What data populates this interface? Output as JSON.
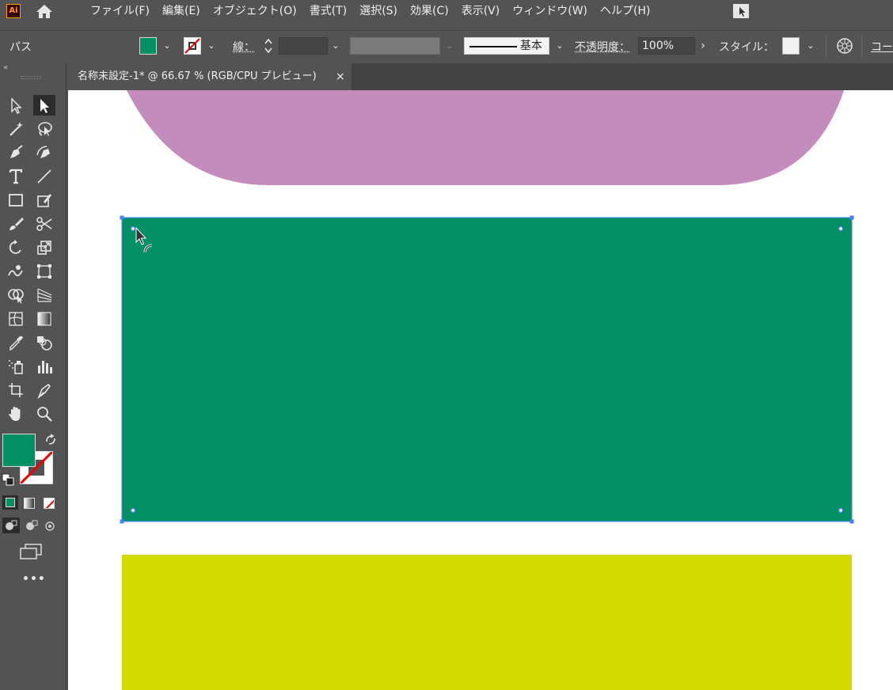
{
  "app": {
    "logo_text": "Ai"
  },
  "menu": [
    "ファイル(F)",
    "編集(E)",
    "オブジェクト(O)",
    "書式(T)",
    "選択(S)",
    "効果(C)",
    "表示(V)",
    "ウィンドウ(W)",
    "ヘルプ(H)"
  ],
  "control_bar": {
    "selection_type": "パス",
    "stroke_label": "線：",
    "stroke_profile": "基本",
    "opacity_label": "不透明度：",
    "opacity_value": "100%",
    "style_label": "スタイル：",
    "overflow_label": "コー"
  },
  "document_tab": {
    "title": "名称未設定-1* @ 66.67 % (RGB/CPU プレビュー)",
    "close": "×"
  },
  "colors": {
    "fill": "#009063",
    "stroke": "none",
    "shape_top": "#c48cbc",
    "shape_middle": "#009063",
    "shape_bottom": "#d2da00",
    "selection": "#4a7dff"
  },
  "toolbox": {
    "more_tools": "•••",
    "tools": [
      "selection-tool",
      "direct-selection-tool",
      "magic-wand-tool",
      "lasso-tool",
      "pen-tool",
      "curvature-tool",
      "type-tool",
      "line-segment-tool",
      "rectangle-tool",
      "shaper-tool",
      "paintbrush-tool",
      "scissors-tool",
      "rotate-tool",
      "scale-tool",
      "warp-tool",
      "free-transform-tool",
      "shape-builder-tool",
      "perspective-grid-tool",
      "mesh-tool",
      "gradient-tool",
      "eyedropper-tool",
      "blend-tool",
      "symbol-sprayer-tool",
      "column-graph-tool",
      "artboard-tool",
      "slice-tool",
      "hand-tool",
      "zoom-tool"
    ]
  }
}
